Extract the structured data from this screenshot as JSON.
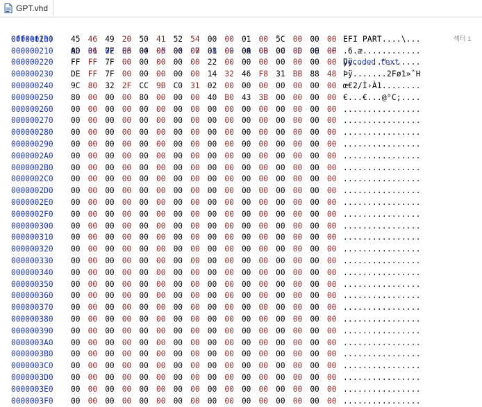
{
  "tab": {
    "title": "GPT.vhd",
    "icon": "file-icon"
  },
  "header": {
    "offset_label": "Offset(h)",
    "columns": [
      "00",
      "01",
      "02",
      "03",
      "04",
      "05",
      "06",
      "07",
      "08",
      "09",
      "0A",
      "0B",
      "0C",
      "0D",
      "0E",
      "0F"
    ],
    "decoded_label": "Decoded text"
  },
  "sector_label": "섹터 1",
  "colors": {
    "header": "#1a33ad",
    "odd_byte": "#8b2a2a",
    "even_byte": "#000000"
  },
  "rows": [
    {
      "offset": "000000200",
      "bytes": [
        "45",
        "46",
        "49",
        "20",
        "50",
        "41",
        "52",
        "54",
        "00",
        "00",
        "01",
        "00",
        "5C",
        "00",
        "00",
        "00"
      ],
      "text": "EFI PART....\\..."
    },
    {
      "offset": "000000210",
      "bytes": [
        "AD",
        "36",
        "7F",
        "E6",
        "00",
        "00",
        "00",
        "00",
        "01",
        "00",
        "00",
        "00",
        "00",
        "00",
        "00",
        "00"
      ],
      "text": ".6.æ............"
    },
    {
      "offset": "000000220",
      "bytes": [
        "FF",
        "FF",
        "7F",
        "00",
        "00",
        "00",
        "00",
        "00",
        "22",
        "00",
        "00",
        "00",
        "00",
        "00",
        "00",
        "00"
      ],
      "text": "ÿÿ......\"......."
    },
    {
      "offset": "000000230",
      "bytes": [
        "DE",
        "FF",
        "7F",
        "00",
        "00",
        "00",
        "00",
        "00",
        "14",
        "32",
        "46",
        "F8",
        "31",
        "BB",
        "88",
        "48"
      ],
      "text": "Þÿ.......2Fø1»ˆH"
    },
    {
      "offset": "000000240",
      "bytes": [
        "9C",
        "80",
        "32",
        "2F",
        "CC",
        "9B",
        "C0",
        "31",
        "02",
        "00",
        "00",
        "00",
        "00",
        "00",
        "00",
        "00"
      ],
      "text": "œ€2/Ì›À1........"
    },
    {
      "offset": "000000250",
      "bytes": [
        "80",
        "00",
        "00",
        "00",
        "80",
        "00",
        "00",
        "00",
        "40",
        "B0",
        "43",
        "3B",
        "00",
        "00",
        "00",
        "00"
      ],
      "text": "€...€...@°C;...."
    },
    {
      "offset": "000000260",
      "bytes": [
        "00",
        "00",
        "00",
        "00",
        "00",
        "00",
        "00",
        "00",
        "00",
        "00",
        "00",
        "00",
        "00",
        "00",
        "00",
        "00"
      ],
      "text": "................"
    },
    {
      "offset": "000000270",
      "bytes": [
        "00",
        "00",
        "00",
        "00",
        "00",
        "00",
        "00",
        "00",
        "00",
        "00",
        "00",
        "00",
        "00",
        "00",
        "00",
        "00"
      ],
      "text": "................"
    },
    {
      "offset": "000000280",
      "bytes": [
        "00",
        "00",
        "00",
        "00",
        "00",
        "00",
        "00",
        "00",
        "00",
        "00",
        "00",
        "00",
        "00",
        "00",
        "00",
        "00"
      ],
      "text": "................"
    },
    {
      "offset": "000000290",
      "bytes": [
        "00",
        "00",
        "00",
        "00",
        "00",
        "00",
        "00",
        "00",
        "00",
        "00",
        "00",
        "00",
        "00",
        "00",
        "00",
        "00"
      ],
      "text": "................"
    },
    {
      "offset": "0000002A0",
      "bytes": [
        "00",
        "00",
        "00",
        "00",
        "00",
        "00",
        "00",
        "00",
        "00",
        "00",
        "00",
        "00",
        "00",
        "00",
        "00",
        "00"
      ],
      "text": "................"
    },
    {
      "offset": "0000002B0",
      "bytes": [
        "00",
        "00",
        "00",
        "00",
        "00",
        "00",
        "00",
        "00",
        "00",
        "00",
        "00",
        "00",
        "00",
        "00",
        "00",
        "00"
      ],
      "text": "................"
    },
    {
      "offset": "0000002C0",
      "bytes": [
        "00",
        "00",
        "00",
        "00",
        "00",
        "00",
        "00",
        "00",
        "00",
        "00",
        "00",
        "00",
        "00",
        "00",
        "00",
        "00"
      ],
      "text": "................"
    },
    {
      "offset": "0000002D0",
      "bytes": [
        "00",
        "00",
        "00",
        "00",
        "00",
        "00",
        "00",
        "00",
        "00",
        "00",
        "00",
        "00",
        "00",
        "00",
        "00",
        "00"
      ],
      "text": "................"
    },
    {
      "offset": "0000002E0",
      "bytes": [
        "00",
        "00",
        "00",
        "00",
        "00",
        "00",
        "00",
        "00",
        "00",
        "00",
        "00",
        "00",
        "00",
        "00",
        "00",
        "00"
      ],
      "text": "................"
    },
    {
      "offset": "0000002F0",
      "bytes": [
        "00",
        "00",
        "00",
        "00",
        "00",
        "00",
        "00",
        "00",
        "00",
        "00",
        "00",
        "00",
        "00",
        "00",
        "00",
        "00"
      ],
      "text": "................"
    },
    {
      "offset": "000000300",
      "bytes": [
        "00",
        "00",
        "00",
        "00",
        "00",
        "00",
        "00",
        "00",
        "00",
        "00",
        "00",
        "00",
        "00",
        "00",
        "00",
        "00"
      ],
      "text": "................"
    },
    {
      "offset": "000000310",
      "bytes": [
        "00",
        "00",
        "00",
        "00",
        "00",
        "00",
        "00",
        "00",
        "00",
        "00",
        "00",
        "00",
        "00",
        "00",
        "00",
        "00"
      ],
      "text": "................"
    },
    {
      "offset": "000000320",
      "bytes": [
        "00",
        "00",
        "00",
        "00",
        "00",
        "00",
        "00",
        "00",
        "00",
        "00",
        "00",
        "00",
        "00",
        "00",
        "00",
        "00"
      ],
      "text": "................"
    },
    {
      "offset": "000000330",
      "bytes": [
        "00",
        "00",
        "00",
        "00",
        "00",
        "00",
        "00",
        "00",
        "00",
        "00",
        "00",
        "00",
        "00",
        "00",
        "00",
        "00"
      ],
      "text": "................"
    },
    {
      "offset": "000000340",
      "bytes": [
        "00",
        "00",
        "00",
        "00",
        "00",
        "00",
        "00",
        "00",
        "00",
        "00",
        "00",
        "00",
        "00",
        "00",
        "00",
        "00"
      ],
      "text": "................"
    },
    {
      "offset": "000000350",
      "bytes": [
        "00",
        "00",
        "00",
        "00",
        "00",
        "00",
        "00",
        "00",
        "00",
        "00",
        "00",
        "00",
        "00",
        "00",
        "00",
        "00"
      ],
      "text": "................"
    },
    {
      "offset": "000000360",
      "bytes": [
        "00",
        "00",
        "00",
        "00",
        "00",
        "00",
        "00",
        "00",
        "00",
        "00",
        "00",
        "00",
        "00",
        "00",
        "00",
        "00"
      ],
      "text": "................"
    },
    {
      "offset": "000000370",
      "bytes": [
        "00",
        "00",
        "00",
        "00",
        "00",
        "00",
        "00",
        "00",
        "00",
        "00",
        "00",
        "00",
        "00",
        "00",
        "00",
        "00"
      ],
      "text": "................"
    },
    {
      "offset": "000000380",
      "bytes": [
        "00",
        "00",
        "00",
        "00",
        "00",
        "00",
        "00",
        "00",
        "00",
        "00",
        "00",
        "00",
        "00",
        "00",
        "00",
        "00"
      ],
      "text": "................"
    },
    {
      "offset": "000000390",
      "bytes": [
        "00",
        "00",
        "00",
        "00",
        "00",
        "00",
        "00",
        "00",
        "00",
        "00",
        "00",
        "00",
        "00",
        "00",
        "00",
        "00"
      ],
      "text": "................"
    },
    {
      "offset": "0000003A0",
      "bytes": [
        "00",
        "00",
        "00",
        "00",
        "00",
        "00",
        "00",
        "00",
        "00",
        "00",
        "00",
        "00",
        "00",
        "00",
        "00",
        "00"
      ],
      "text": "................"
    },
    {
      "offset": "0000003B0",
      "bytes": [
        "00",
        "00",
        "00",
        "00",
        "00",
        "00",
        "00",
        "00",
        "00",
        "00",
        "00",
        "00",
        "00",
        "00",
        "00",
        "00"
      ],
      "text": "................"
    },
    {
      "offset": "0000003C0",
      "bytes": [
        "00",
        "00",
        "00",
        "00",
        "00",
        "00",
        "00",
        "00",
        "00",
        "00",
        "00",
        "00",
        "00",
        "00",
        "00",
        "00"
      ],
      "text": "................"
    },
    {
      "offset": "0000003D0",
      "bytes": [
        "00",
        "00",
        "00",
        "00",
        "00",
        "00",
        "00",
        "00",
        "00",
        "00",
        "00",
        "00",
        "00",
        "00",
        "00",
        "00"
      ],
      "text": "................"
    },
    {
      "offset": "0000003E0",
      "bytes": [
        "00",
        "00",
        "00",
        "00",
        "00",
        "00",
        "00",
        "00",
        "00",
        "00",
        "00",
        "00",
        "00",
        "00",
        "00",
        "00"
      ],
      "text": "................"
    },
    {
      "offset": "0000003F0",
      "bytes": [
        "00",
        "00",
        "00",
        "00",
        "00",
        "00",
        "00",
        "00",
        "00",
        "00",
        "00",
        "00",
        "00",
        "00",
        "00",
        "00"
      ],
      "text": "................"
    }
  ]
}
